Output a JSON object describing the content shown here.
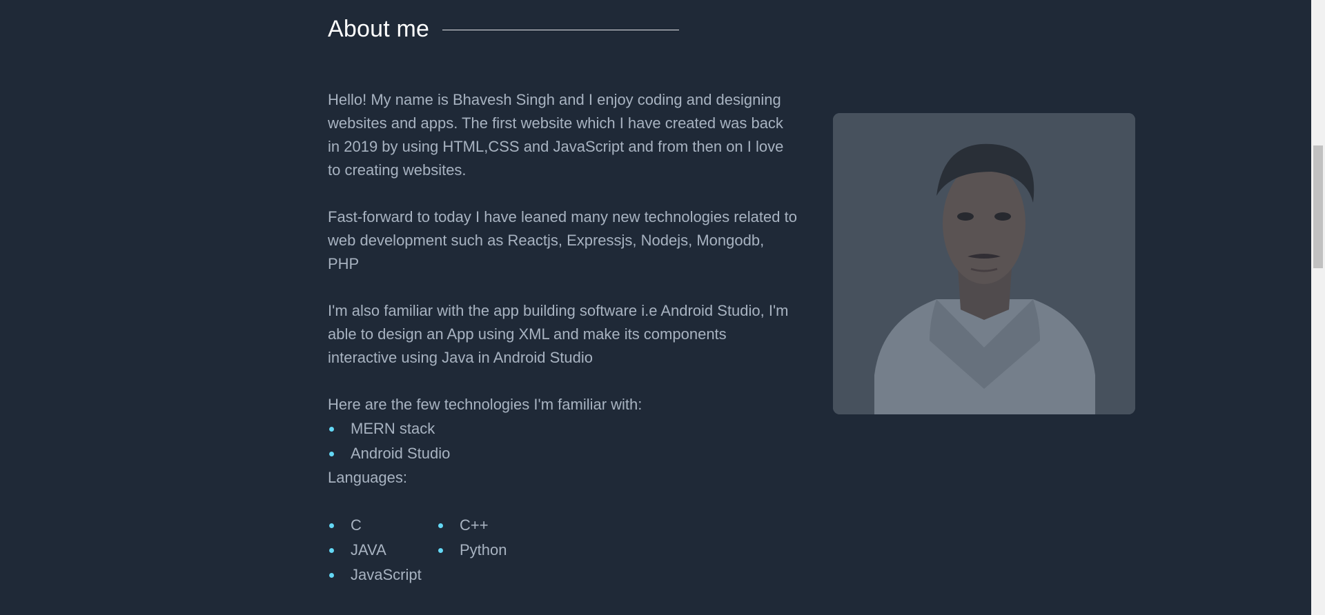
{
  "about": {
    "title": "About me",
    "paragraphs": {
      "p1": "Hello! My name is Bhavesh Singh and I enjoy coding and designing websites and apps. The first website which I have created was back in 2019 by using HTML,CSS and JavaScript and from then on I love to creating websites.",
      "p2": "Fast-forward to today I have leaned many new technologies related to web development such as Reactjs, Expressjs, Nodejs, Mongodb, PHP",
      "p3": "I'm also familiar with the app building software i.e Android Studio, I'm able to design an App using XML and make its components interactive using Java in Android Studio",
      "p4": "Here are the few technologies I'm familiar with:"
    },
    "technologies": [
      "MERN stack",
      "Android Studio"
    ],
    "languages_label": "Languages:",
    "languages": [
      "C",
      "C++",
      "JAVA",
      "Python",
      "JavaScript"
    ]
  },
  "colors": {
    "background": "#1f2937",
    "text": "#a8b3c1",
    "heading": "#ffffff",
    "bullet": "#64d8f5"
  },
  "icons": {
    "profile_photo": "profile-photo"
  }
}
